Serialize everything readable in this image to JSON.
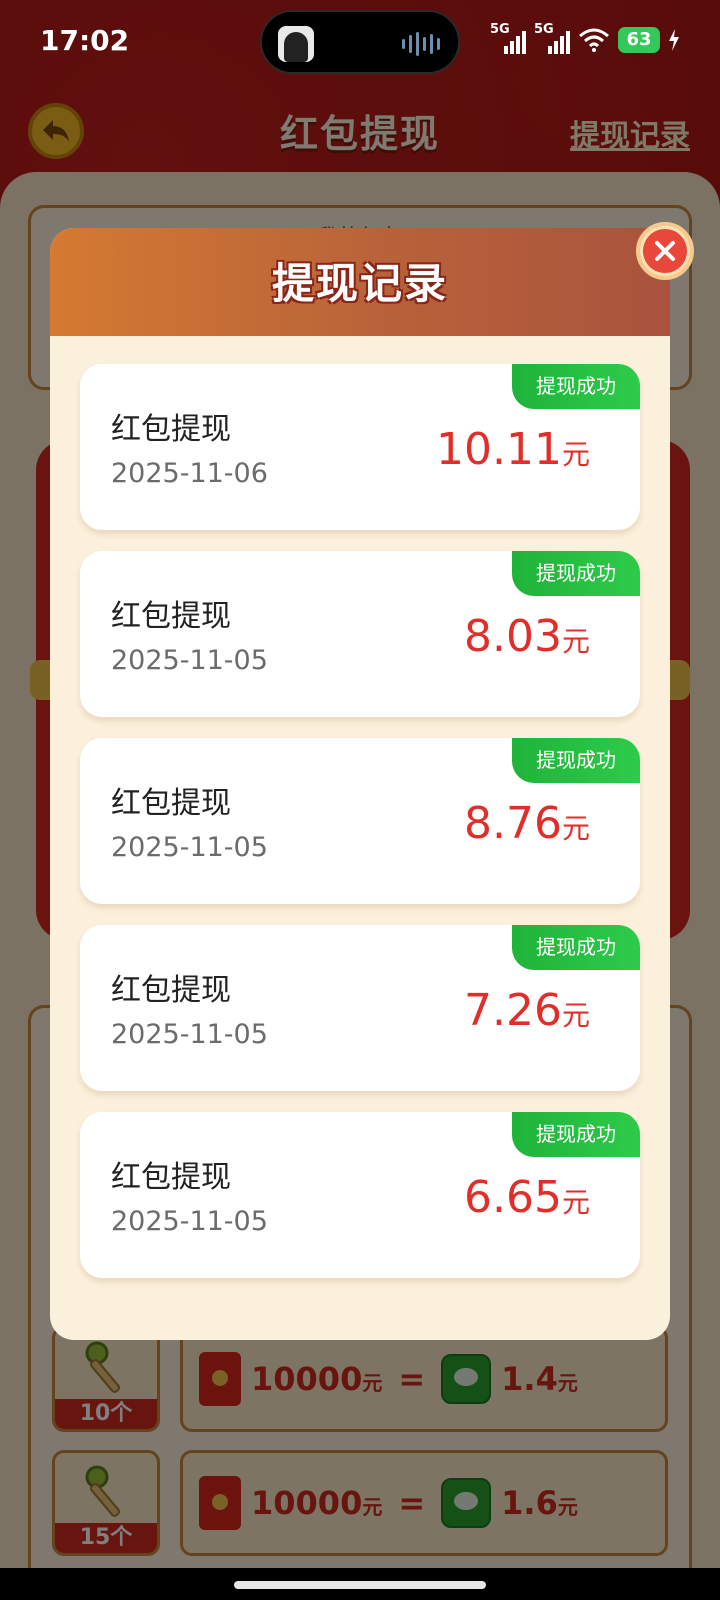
{
  "status_bar": {
    "time": "17:02",
    "network_1": "5G",
    "network_2": "5G",
    "battery": "63"
  },
  "background": {
    "header_title": "红包提现",
    "record_link": "提现记录",
    "top_card_label": "我的红包",
    "exchange_rows": [
      {
        "key_count": "10个",
        "amount": "10000",
        "unit": "元",
        "eq": "=",
        "cash": "1.4",
        "cash_unit": "元"
      },
      {
        "key_count": "15个",
        "amount": "10000",
        "unit": "元",
        "eq": "=",
        "cash": "1.6",
        "cash_unit": "元"
      }
    ]
  },
  "modal": {
    "title": "提现记录",
    "records": [
      {
        "title": "红包提现",
        "date": "2025-11-06",
        "amount": "10.11",
        "unit": "元",
        "status": "提现成功"
      },
      {
        "title": "红包提现",
        "date": "2025-11-05",
        "amount": "8.03",
        "unit": "元",
        "status": "提现成功"
      },
      {
        "title": "红包提现",
        "date": "2025-11-05",
        "amount": "8.76",
        "unit": "元",
        "status": "提现成功"
      },
      {
        "title": "红包提现",
        "date": "2025-11-05",
        "amount": "7.26",
        "unit": "元",
        "status": "提现成功"
      },
      {
        "title": "红包提现",
        "date": "2025-11-05",
        "amount": "6.65",
        "unit": "元",
        "status": "提现成功"
      }
    ]
  },
  "colors": {
    "accent_red": "#e02f2a",
    "success_green": "#1fb33a",
    "modal_bg": "#fbf0db"
  },
  "icons": {
    "back": "back-arrow-icon",
    "close": "close-icon",
    "key": "key-icon",
    "red_envelope": "red-envelope-icon",
    "wechat": "wechat-icon"
  }
}
